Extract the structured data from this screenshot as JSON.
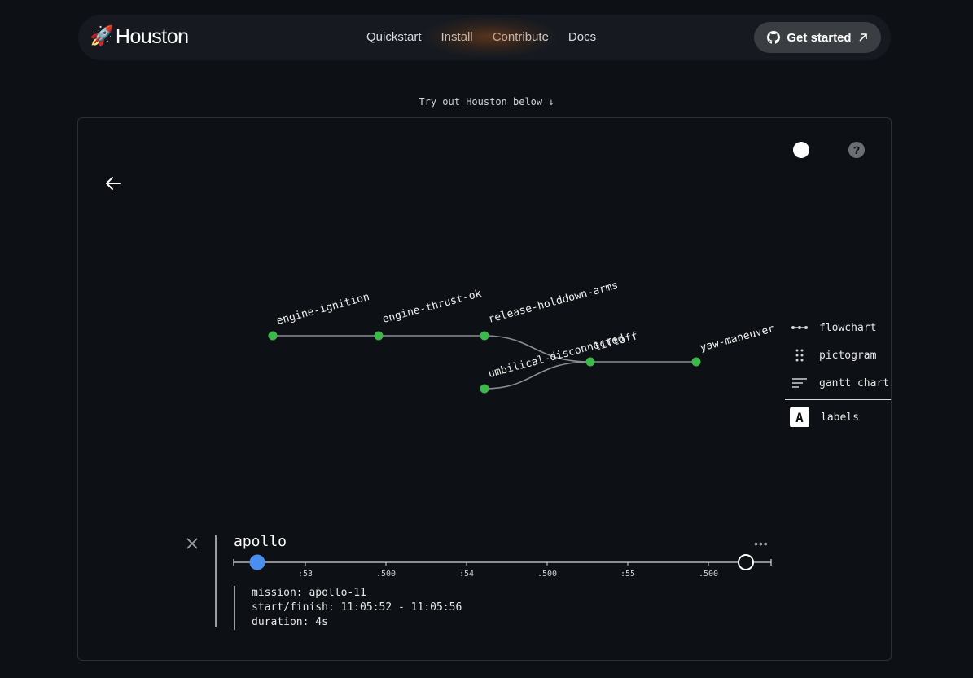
{
  "nav": {
    "logo_emoji": "🚀",
    "logo_text": "Houston",
    "links": [
      "Quickstart",
      "Install",
      "Contribute",
      "Docs"
    ],
    "cta_label": "Get started",
    "cta_icon": "github-icon"
  },
  "tryout_text": "Try out Houston below ↓",
  "panel": {
    "help_label": "?",
    "theme_toggle_on": false,
    "graph_nodes": [
      "engine-ignition",
      "engine-thrust-ok",
      "release-holddown-arms",
      "umbilical-disconnected",
      "liftoff",
      "yaw-maneuver"
    ],
    "graph_edges": [
      [
        "engine-ignition",
        "engine-thrust-ok"
      ],
      [
        "engine-thrust-ok",
        "release-holddown-arms"
      ],
      [
        "release-holddown-arms",
        "liftoff"
      ],
      [
        "umbilical-disconnected",
        "liftoff"
      ],
      [
        "liftoff",
        "yaw-maneuver"
      ]
    ],
    "views": {
      "flowchart": "flowchart",
      "pictogram": "pictogram",
      "gantt": "gantt chart",
      "labels": "labels",
      "labels_icon_letter": "A"
    },
    "timeline": {
      "trace_name": "apollo",
      "ticks": [
        ":53",
        ".500",
        ":54",
        ".500",
        ":55",
        ".500"
      ],
      "more_label": "•••",
      "position_fraction": 0.04,
      "start_marker_color": "#4a8ff0"
    },
    "details": {
      "mission": "mission: apollo-11",
      "start_finish": "start/finish: 11:05:52 - 11:05:56",
      "duration": "duration: 4s"
    }
  },
  "colors": {
    "background": "#0d1014",
    "node": "#3db84a",
    "edge": "#8a8d92",
    "accent_blue": "#4a8ff0"
  }
}
